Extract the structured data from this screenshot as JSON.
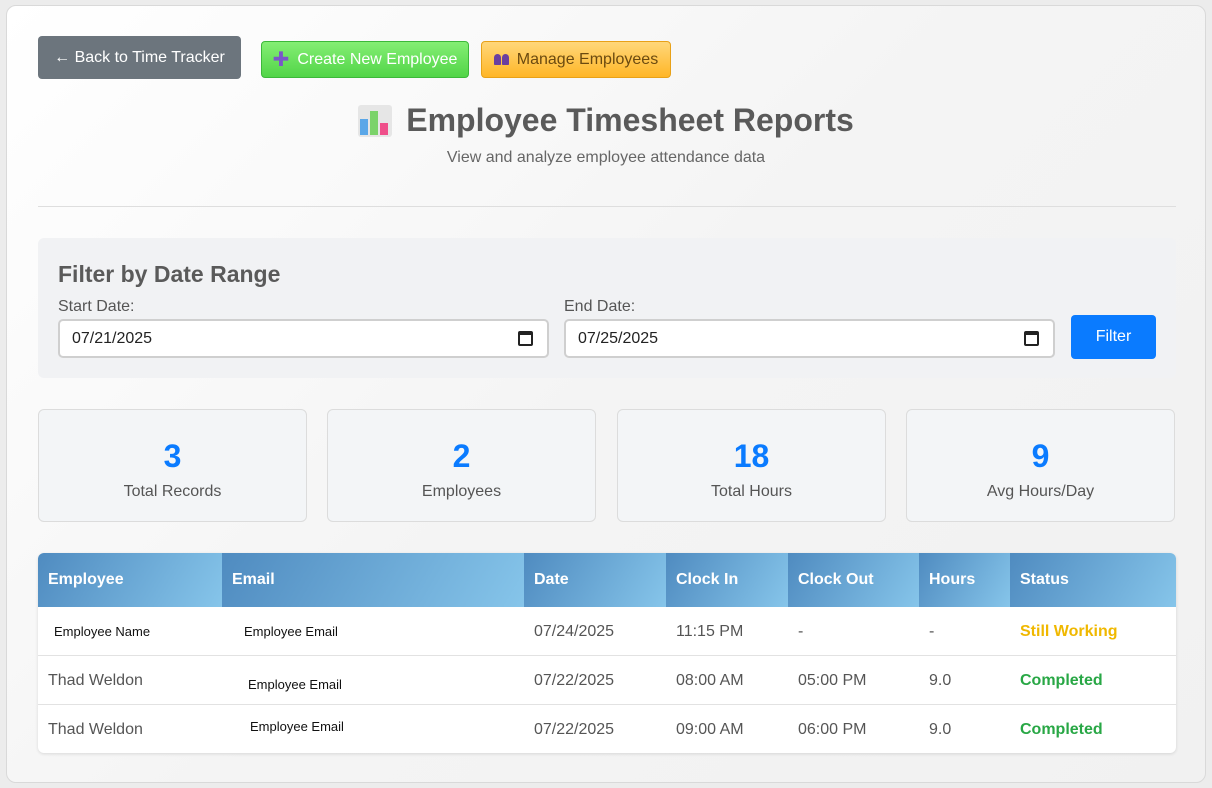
{
  "header": {
    "back_label": "← Back to Time Tracker",
    "create_label": "Create New Employee",
    "manage_label": "Manage Employees",
    "title": "Employee Timesheet Reports",
    "subtitle": "View and analyze employee attendance data"
  },
  "filter": {
    "title": "Filter by Date Range",
    "start_label": "Start Date:",
    "start_value": "07/21/2025",
    "end_label": "End Date:",
    "end_value": "07/25/2025",
    "button_label": "Filter"
  },
  "stats": [
    {
      "value": "3",
      "label": "Total Records"
    },
    {
      "value": "2",
      "label": "Employees"
    },
    {
      "value": "18",
      "label": "Total Hours"
    },
    {
      "value": "9",
      "label": "Avg Hours/Day"
    }
  ],
  "table": {
    "headers": [
      "Employee",
      "Email",
      "Date",
      "Clock In",
      "Clock Out",
      "Hours",
      "Status"
    ],
    "rows": [
      {
        "employee": "Employee Name",
        "email": "Employee Email",
        "date": "07/24/2025",
        "clock_in": "11:15 PM",
        "clock_out": "-",
        "hours": "-",
        "status": "Still Working"
      },
      {
        "employee": "Thad Weldon",
        "email": "Employee Email",
        "date": "07/22/2025",
        "clock_in": "08:00 AM",
        "clock_out": "05:00 PM",
        "hours": "9.0",
        "status": "Completed"
      },
      {
        "employee": "Thad Weldon",
        "email": "Employee Email",
        "date": "07/22/2025",
        "clock_in": "09:00 AM",
        "clock_out": "06:00 PM",
        "hours": "9.0",
        "status": "Completed"
      }
    ]
  },
  "colors": {
    "primary": "#0a7bff",
    "working": "#f0b800",
    "completed": "#28a745"
  },
  "icons": [
    "plus-icon",
    "people-icon",
    "bar-chart-icon",
    "calendar-icon"
  ]
}
